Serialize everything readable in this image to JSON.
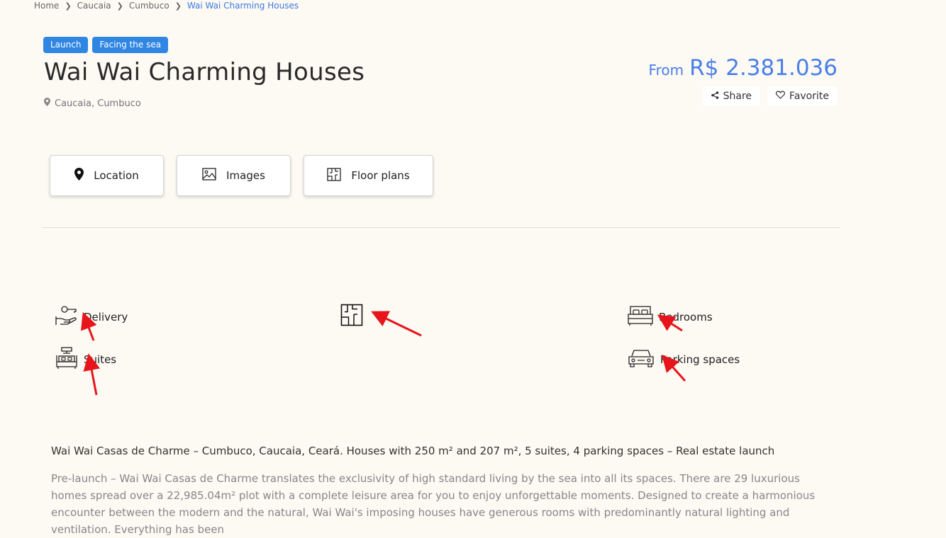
{
  "breadcrumb": [
    "Home",
    "Caucaia",
    "Cumbuco",
    "Wai Wai Charming Houses"
  ],
  "tags": [
    "Launch",
    "Facing the sea"
  ],
  "property": {
    "title": "Wai Wai Charming Houses",
    "location": "Caucaia, Cumbuco",
    "price_prefix": "From",
    "price": "R$ 2.381.036"
  },
  "actions": {
    "share": "Share",
    "favorite": "Favorite"
  },
  "tabs": {
    "location": "Location",
    "images": "Images",
    "floor_plans": "Floor plans"
  },
  "features": {
    "delivery": "Delivery",
    "suites": "Suites",
    "bedrooms": "Bedrooms",
    "parking": "Parking spaces"
  },
  "annotation_color": "#e8141b",
  "description": {
    "lead": "Wai Wai Casas de Charme – Cumbuco, Caucaia, Ceará. Houses with 250 m² and 207 m², 5 suites, 4 parking spaces – Real estate launch",
    "body": "Pre-launch – Wai Wai Casas de Charme translates the exclusivity of high standard living by the sea into all its spaces. There are 29 luxurious homes spread over a 22,985.04m² plot with a complete leisure area for you to enjoy unforgettable moments. Designed to create a harmonious encounter between the modern and the natural, Wai Wai's imposing houses have generous rooms with predominantly natural lighting and ventilation. Everything has been"
  }
}
